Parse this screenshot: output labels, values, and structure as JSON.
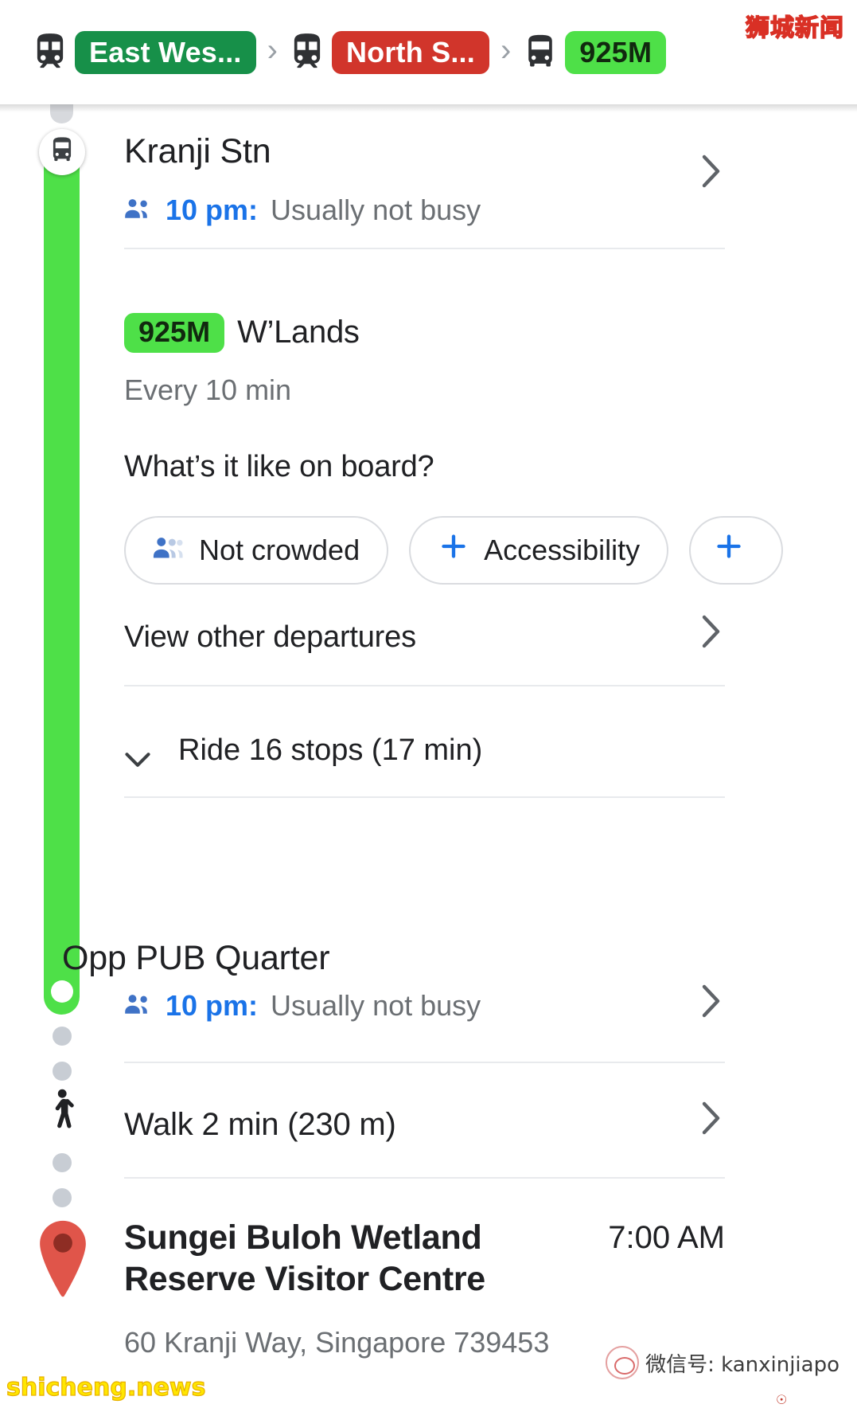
{
  "route_bar": {
    "legs": [
      {
        "icon": "train-icon",
        "label": "East Wes...",
        "color": "#179049",
        "type": "rail"
      },
      {
        "icon": "train-icon",
        "label": "North S...",
        "color": "#d1352b",
        "type": "rail"
      },
      {
        "icon": "bus-icon",
        "label": "925M",
        "color": "#4ee048",
        "type": "bus"
      }
    ],
    "separator": "›"
  },
  "steps": {
    "boarding_stop": {
      "name": "Kranji Stn",
      "busy_time": "10 pm:",
      "busy_status": "Usually not busy",
      "icon": "bus-icon",
      "chevron": "chevron-right-icon"
    },
    "service": {
      "badge": "925M",
      "destination": "W’Lands",
      "frequency": "Every 10 min",
      "onboard_question": "What’s it like on board?",
      "chips": [
        {
          "icon": "crowd-level-icon",
          "label": "Not crowded"
        },
        {
          "icon": "plus-icon",
          "label": "Accessibility"
        },
        {
          "icon": "plus-icon",
          "label": ""
        }
      ],
      "other_departures": "View other departures",
      "ride_summary": "Ride 16 stops (17 min)"
    },
    "alighting_stop": {
      "name": "Opp PUB Quarter",
      "busy_time": "10 pm:",
      "busy_status": "Usually not busy",
      "chevron": "chevron-right-icon"
    },
    "walk": {
      "label": "Walk 2 min (230 m)",
      "icon": "pedestrian-icon",
      "chevron": "chevron-right-icon"
    },
    "destination": {
      "name": "Sungei Buloh Wetland Reserve Visitor Centre",
      "arrival_time": "7:00 AM",
      "address": "60 Kranji Way, Singapore 739453",
      "icon": "map-pin-icon"
    }
  },
  "watermarks": {
    "top_right": "狮城新闻",
    "bottom_left": "shicheng.news",
    "wechat": "微信号: kanxinjiapo"
  },
  "colors": {
    "ewl_green": "#179049",
    "nsl_red": "#d1352b",
    "bus_green": "#4ee048",
    "link_blue": "#1a73e8",
    "muted": "#6b6f73",
    "pin_red": "#e0554a"
  }
}
